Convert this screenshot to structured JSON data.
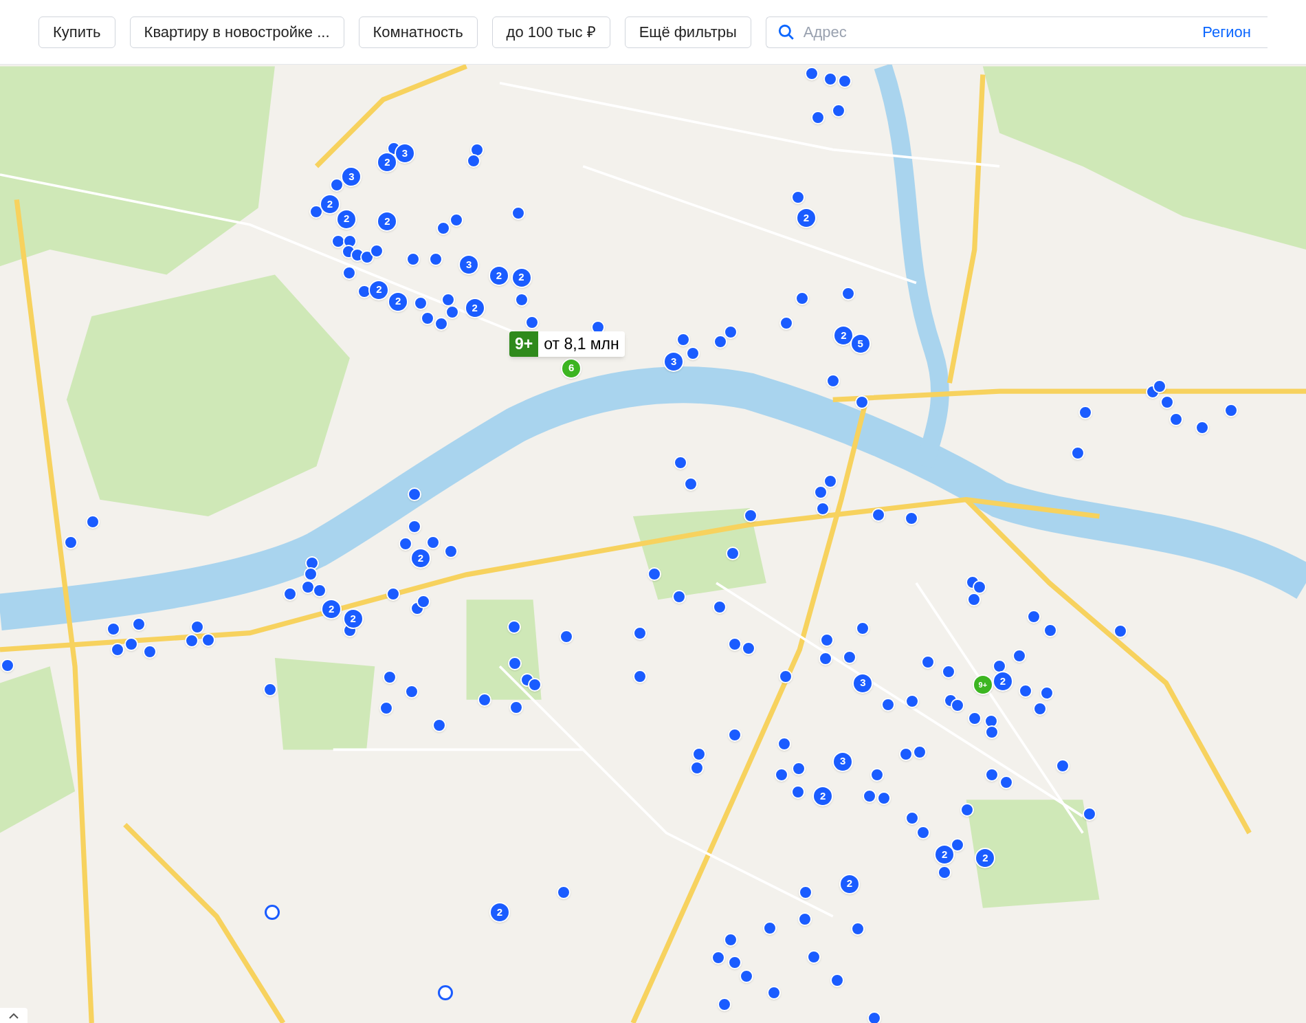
{
  "filters": [
    {
      "label": "Купить"
    },
    {
      "label": "Квартиру в новостройке ..."
    },
    {
      "label": "Комнатность"
    },
    {
      "label": "до 100 тыс ₽"
    },
    {
      "label": "Ещё фильтры"
    }
  ],
  "search": {
    "placeholder": "Адрес",
    "region_link": "Регион"
  },
  "price_tooltip": {
    "count": "9+",
    "price": "от 8,1 млн"
  },
  "clusters": [
    {
      "label": "3",
      "color": "#1a5cff"
    },
    {
      "label": "2",
      "color": "#1a5cff"
    },
    {
      "label": "3",
      "color": "#1a5cff"
    },
    {
      "label": "2",
      "color": "#1a5cff"
    },
    {
      "label": "2",
      "color": "#1a5cff"
    },
    {
      "label": "2",
      "color": "#1a5cff"
    },
    {
      "label": "3",
      "color": "#1a5cff"
    },
    {
      "label": "2",
      "color": "#1a5cff"
    },
    {
      "label": "2",
      "color": "#1a5cff"
    },
    {
      "label": "2",
      "color": "#1a5cff"
    },
    {
      "label": "2",
      "color": "#1a5cff"
    },
    {
      "label": "2",
      "color": "#1a5cff"
    },
    {
      "label": "2",
      "color": "#1a5cff"
    },
    {
      "label": "2",
      "color": "#1a5cff"
    },
    {
      "label": "5",
      "color": "#1a5cff"
    },
    {
      "label": "3",
      "color": "#1a5cff"
    },
    {
      "label": "2",
      "color": "#1a5cff"
    },
    {
      "label": "2",
      "color": "#1a5cff"
    },
    {
      "label": "2",
      "color": "#1a5cff"
    },
    {
      "label": "3",
      "color": "#1a5cff"
    },
    {
      "label": "2",
      "color": "#1a5cff"
    },
    {
      "label": "3",
      "color": "#1a5cff"
    },
    {
      "label": "2",
      "color": "#1a5cff"
    },
    {
      "label": "2",
      "color": "#1a5cff"
    },
    {
      "label": "2",
      "color": "#1a5cff"
    },
    {
      "label": "2",
      "color": "#1a5cff"
    },
    {
      "label": "2",
      "color": "#1a5cff"
    },
    {
      "label": "9+",
      "color": "#3cb521"
    },
    {
      "label": "6",
      "color": "#3cb521"
    }
  ]
}
